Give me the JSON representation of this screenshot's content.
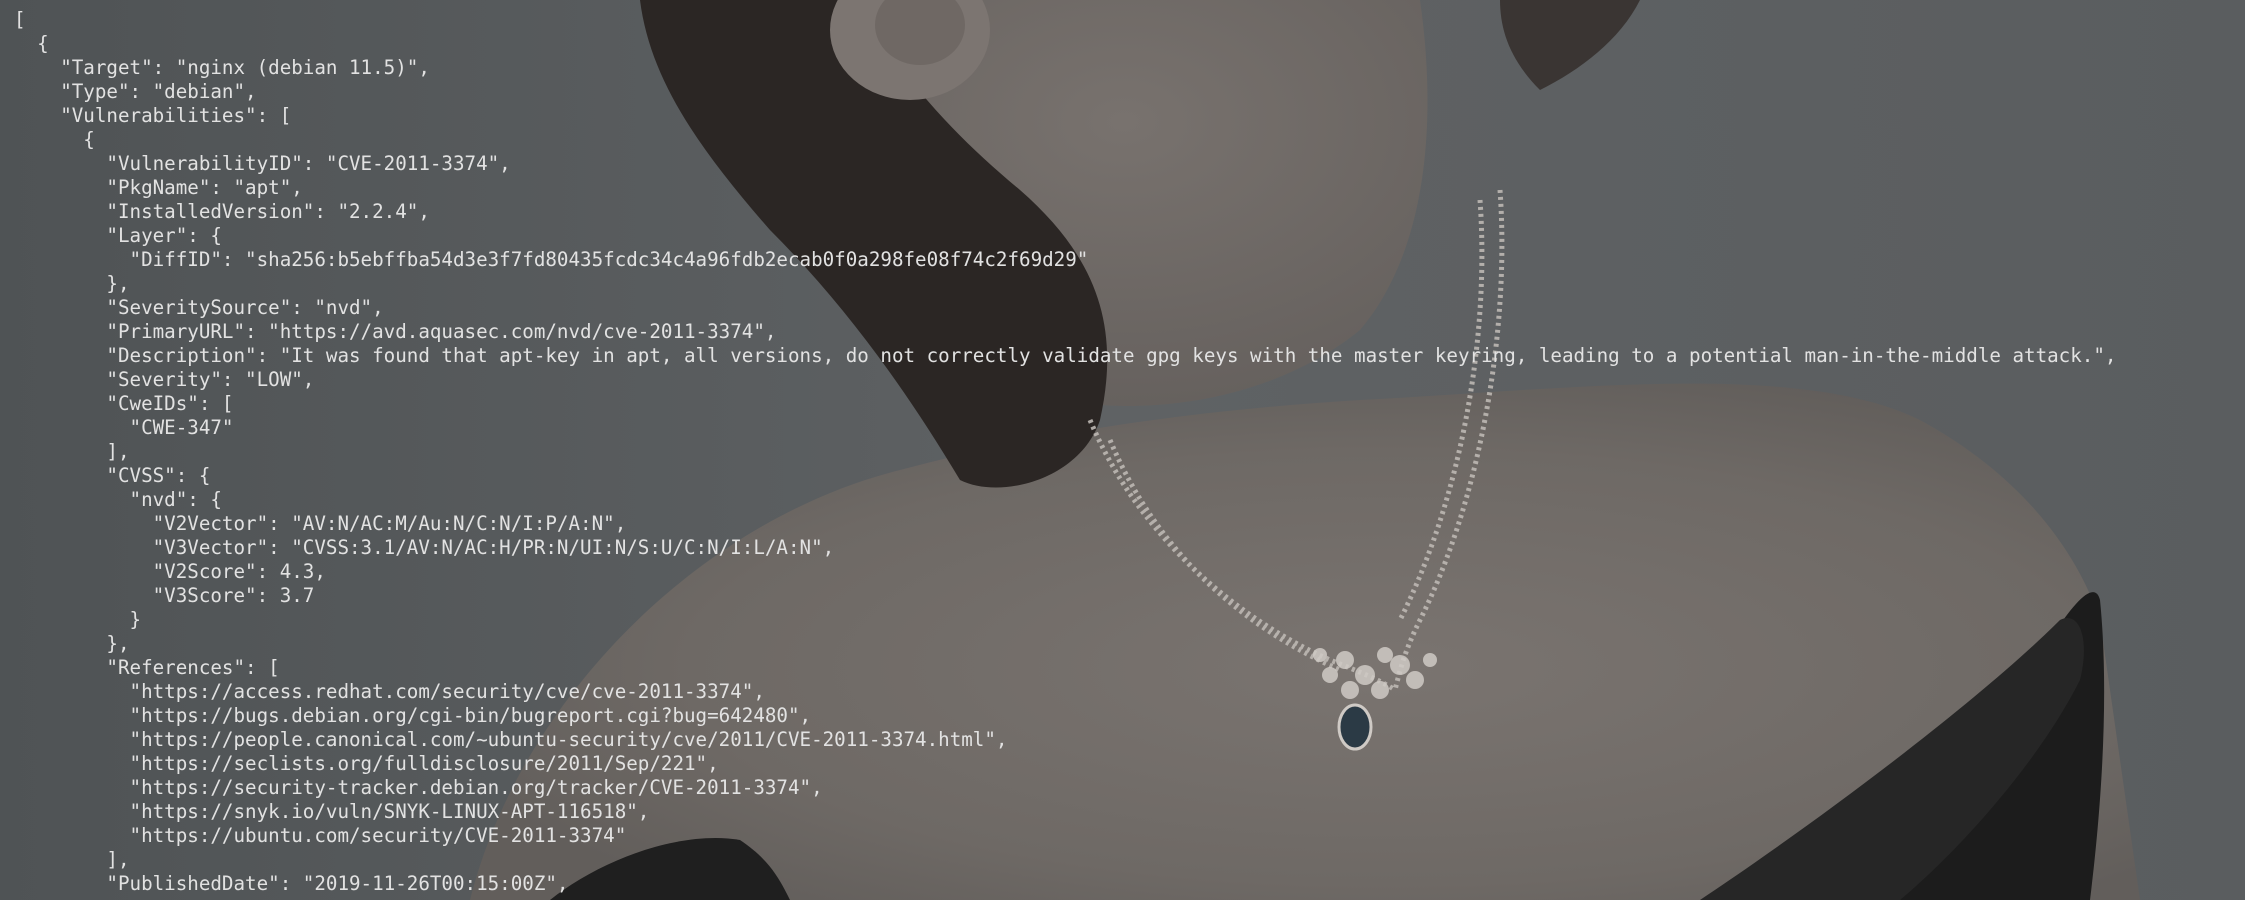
{
  "terminal": {
    "lines": [
      "[",
      "  {",
      "    \"Target\": \"nginx (debian 11.5)\",",
      "    \"Type\": \"debian\",",
      "    \"Vulnerabilities\": [",
      "      {",
      "        \"VulnerabilityID\": \"CVE-2011-3374\",",
      "        \"PkgName\": \"apt\",",
      "        \"InstalledVersion\": \"2.2.4\",",
      "        \"Layer\": {",
      "          \"DiffID\": \"sha256:b5ebffba54d3e3f7fd80435fcdc34c4a96fdb2ecab0f0a298fe08f74c2f69d29\"",
      "        },",
      "        \"SeveritySource\": \"nvd\",",
      "        \"PrimaryURL\": \"https://avd.aquasec.com/nvd/cve-2011-3374\",",
      "        \"Description\": \"It was found that apt-key in apt, all versions, do not correctly validate gpg keys with the master keyring, leading to a potential man-in-the-middle attack.\",",
      "        \"Severity\": \"LOW\",",
      "        \"CweIDs\": [",
      "          \"CWE-347\"",
      "        ],",
      "        \"CVSS\": {",
      "          \"nvd\": {",
      "            \"V2Vector\": \"AV:N/AC:M/Au:N/C:N/I:P/A:N\",",
      "            \"V3Vector\": \"CVSS:3.1/AV:N/AC:H/PR:N/UI:N/S:U/C:N/I:L/A:N\",",
      "            \"V2Score\": 4.3,",
      "            \"V3Score\": 3.7",
      "          }",
      "        },",
      "        \"References\": [",
      "          \"https://access.redhat.com/security/cve/cve-2011-3374\",",
      "          \"https://bugs.debian.org/cgi-bin/bugreport.cgi?bug=642480\",",
      "          \"https://people.canonical.com/~ubuntu-security/cve/2011/CVE-2011-3374.html\",",
      "          \"https://seclists.org/fulldisclosure/2011/Sep/221\",",
      "          \"https://security-tracker.debian.org/tracker/CVE-2011-3374\",",
      "          \"https://snyk.io/vuln/SNYK-LINUX-APT-116518\",",
      "          \"https://ubuntu.com/security/CVE-2011-3374\"",
      "        ],",
      "        \"PublishedDate\": \"2019-11-26T00:15:00Z\","
    ]
  }
}
